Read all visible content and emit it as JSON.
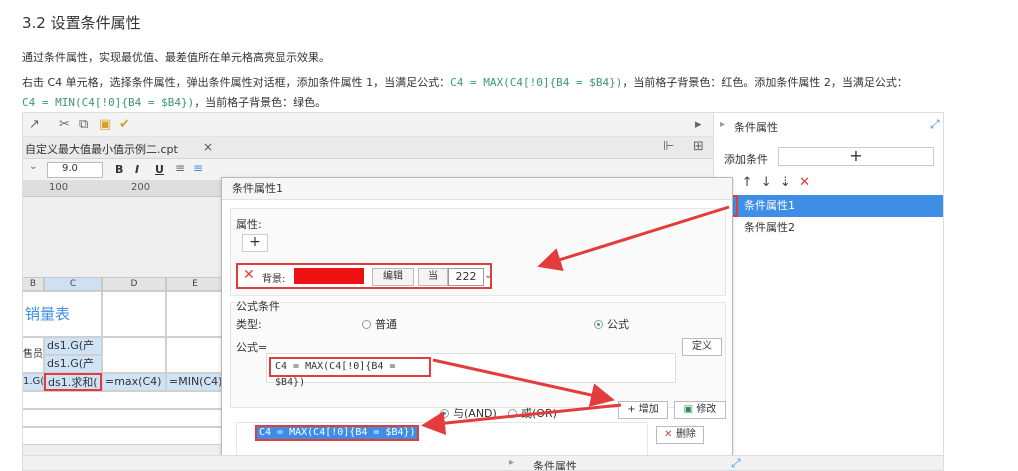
{
  "heading": "3.2 设置条件属性",
  "para1": "通过条件属性，实现最优值、最差值所在单元格高亮显示效果。",
  "para2": {
    "pre": "右击 C4 单元格，选择条件属性，弹出条件属性对话框，添加条件属性 1，当满足公式：",
    "code1": "C4 = MAX(C4[!0]{B4 = $B4})",
    "mid": "，当前格子背景色：红色。添加条件属性 2，当满足公式：",
    "code2": "C4 = MIN(C4[!0]{B4 = $B4})",
    "post": "，当前格子背景色：绿色。"
  },
  "designer": {
    "tab_name": "自定义最大值最小值示例二.cpt",
    "tab_close": "×",
    "font_size": "9.0",
    "fmt": {
      "bold": "B",
      "italic": "I",
      "underline": "U"
    },
    "ruler": [
      "100",
      "200"
    ],
    "columns": [
      "B",
      "C",
      "D",
      "E"
    ],
    "cells": {
      "title": "销量表",
      "c2": "ds1.G(产",
      "c3": "ds1.G(产",
      "b3": "售员",
      "b4": "1.G(",
      "c4": "ds1.求和(",
      "d4": "=max(C4)",
      "e4": "=MIN(C4)"
    }
  },
  "right_panel": {
    "title": "条件属性",
    "add_label": "添加条件",
    "add_button": "+",
    "tools": {
      "copy": "⧉",
      "up": "↑",
      "down": "↓",
      "sort": "⇣",
      "delete": "✕"
    },
    "items": [
      "条件属性1",
      "条件属性2"
    ]
  },
  "dialog": {
    "title": "条件属性1",
    "attr_label": "属性:",
    "add_attr": "+",
    "bg_label": "背景:",
    "bg_color": "#ee1111",
    "edit_button": "编辑",
    "current_btn": "当",
    "tooltip": "222",
    "formula_section": "公式条件",
    "type_label": "类型:",
    "type_normal": "普通",
    "type_formula": "公式",
    "formula_label": "公式=",
    "formula_value": "C4 = MAX(C4[!0]{B4 = $B4})",
    "define_button": "定义",
    "and_label": "与(AND)",
    "or_label": "或(OR)",
    "add_button": "增加",
    "modify_button": "修改",
    "delete_button": "删除",
    "condition_item": "C4 = MAX(C4[!0]{B4 = $B4})"
  },
  "bottom_panel_title": "条件属性"
}
